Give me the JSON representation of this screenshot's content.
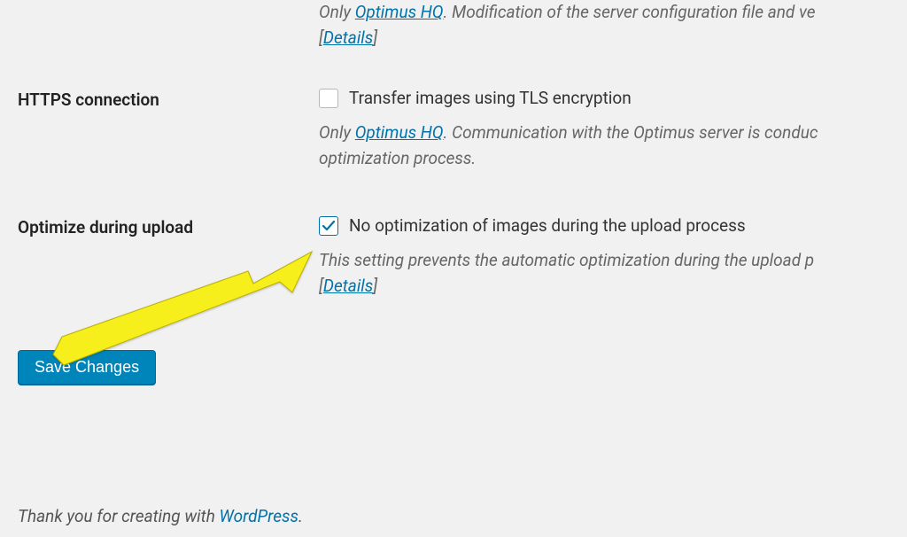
{
  "prev_section": {
    "desc_prefix": "Only ",
    "desc_link": "Optimus HQ",
    "desc_suffix": ". Modification of the server configuration file and ve",
    "details": "Details"
  },
  "sections": {
    "https": {
      "label": "HTTPS connection",
      "checkbox_label": "Transfer images using TLS encryption",
      "checked": false,
      "desc_prefix": "Only ",
      "desc_link": "Optimus HQ",
      "desc_suffix": ". Communication with the Optimus server is conduc",
      "desc_line2": "optimization process."
    },
    "optimize": {
      "label": "Optimize during upload",
      "checkbox_label": "No optimization of images during the upload process",
      "checked": true,
      "desc_line1": "This setting prevents the automatic optimization during the upload p",
      "details": "Details"
    }
  },
  "save_button": "Save Changes",
  "footer": {
    "text": "Thank you for creating with ",
    "wp": "WordPress",
    "period": "."
  }
}
